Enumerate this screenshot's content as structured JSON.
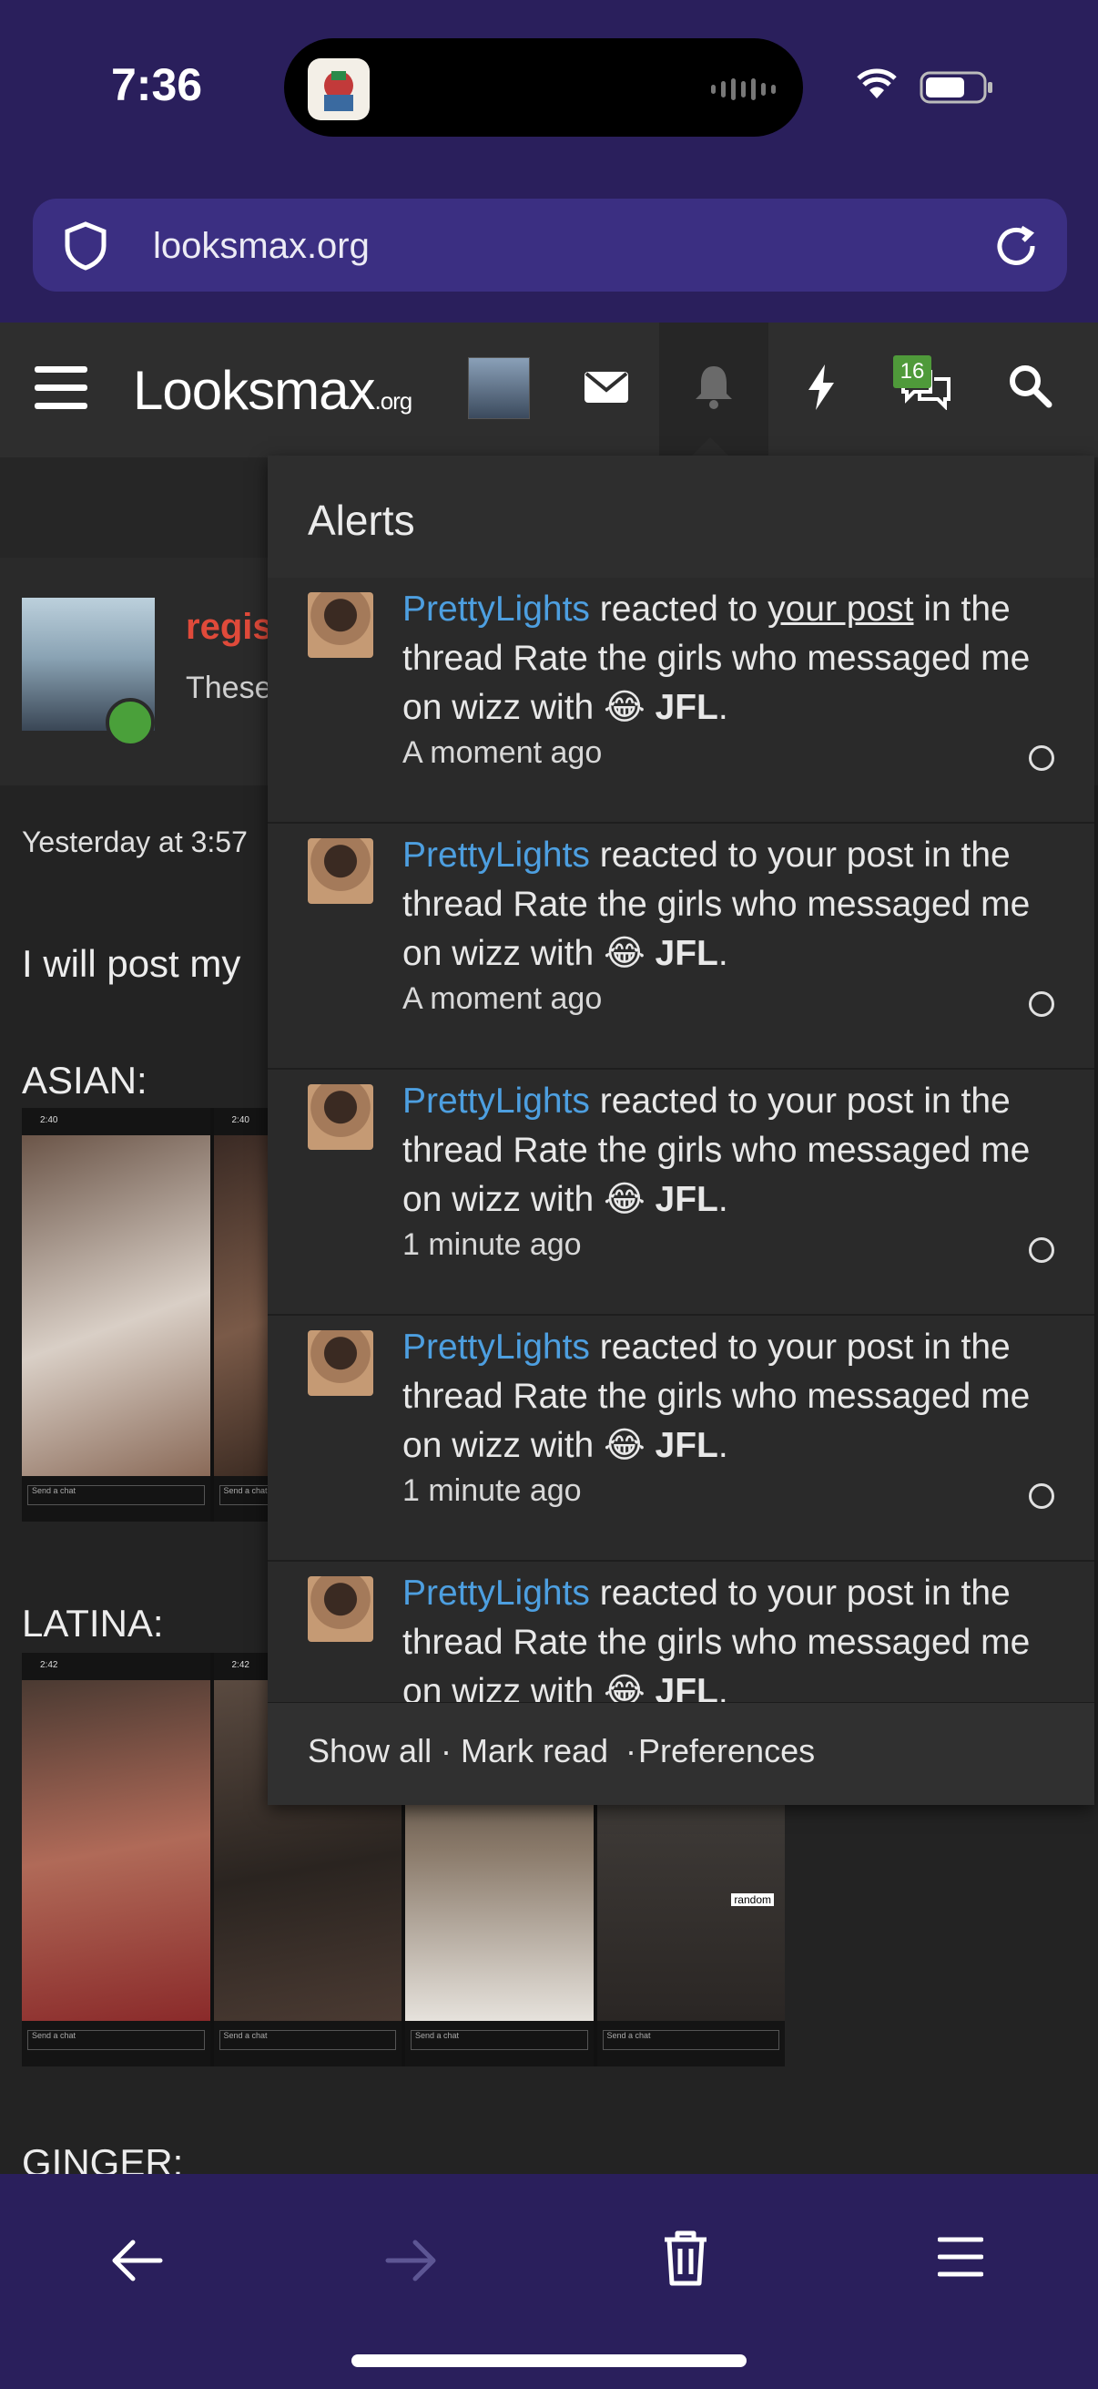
{
  "status_bar": {
    "time": "7:36"
  },
  "browser": {
    "url": "looksmax.org"
  },
  "site": {
    "logo_main": "Looksmax",
    "logo_suffix": ".org",
    "conversation_badge": "16"
  },
  "post": {
    "username": "regis",
    "user_title": "These",
    "date": "Yesterday at 3:57",
    "text": "I will post my",
    "sections": [
      "ASIAN:",
      "LATINA:",
      "GINGER:"
    ],
    "chat_placeholder": "Send a chat",
    "chat_times": [
      "2:40",
      "2:42"
    ],
    "random_tag": "random"
  },
  "alerts": {
    "title": "Alerts",
    "items": [
      {
        "user": "PrettyLights",
        "action": "reacted to",
        "link": "your post",
        "suffix": "in the thread Rate the girls who messaged me on wizz with",
        "emoji": "😂",
        "reaction": "JFL",
        "time": "A moment ago",
        "underlined": true
      },
      {
        "user": "PrettyLights",
        "action": "reacted to",
        "link": "your post",
        "suffix": "in the thread Rate the girls who messaged me on wizz with",
        "emoji": "😂",
        "reaction": "JFL",
        "time": "A moment ago",
        "underlined": false
      },
      {
        "user": "PrettyLights",
        "action": "reacted to",
        "link": "your post",
        "suffix": "in the thread Rate the girls who messaged me on wizz with",
        "emoji": "😂",
        "reaction": "JFL",
        "time": "1 minute ago",
        "underlined": false
      },
      {
        "user": "PrettyLights",
        "action": "reacted to",
        "link": "your post",
        "suffix": "in the thread Rate the girls who messaged me on wizz with",
        "emoji": "😂",
        "reaction": "JFL",
        "time": "1 minute ago",
        "underlined": false
      },
      {
        "user": "PrettyLights",
        "action": "reacted to",
        "link": "your post",
        "suffix": "in the thread Rate the girls who messaged me on wizz with",
        "emoji": "😂",
        "reaction": "JFL",
        "time": "",
        "underlined": false
      }
    ],
    "footer": {
      "show_all": "Show all",
      "mark_read": "Mark read",
      "preferences": "Preferences",
      "sep": "·"
    }
  },
  "colors": {
    "chrome": "#2a1f5c",
    "urlbar": "#3b2f82",
    "link": "#4d9fe0",
    "badge": "#4f9a3a",
    "username": "#e04a3a"
  },
  "icons": [
    "shield-icon",
    "reload-icon",
    "menu-icon",
    "mail-icon",
    "bell-icon",
    "bolt-icon",
    "chat-icon",
    "search-icon",
    "back-icon",
    "forward-icon",
    "trash-icon",
    "browser-menu-icon"
  ]
}
